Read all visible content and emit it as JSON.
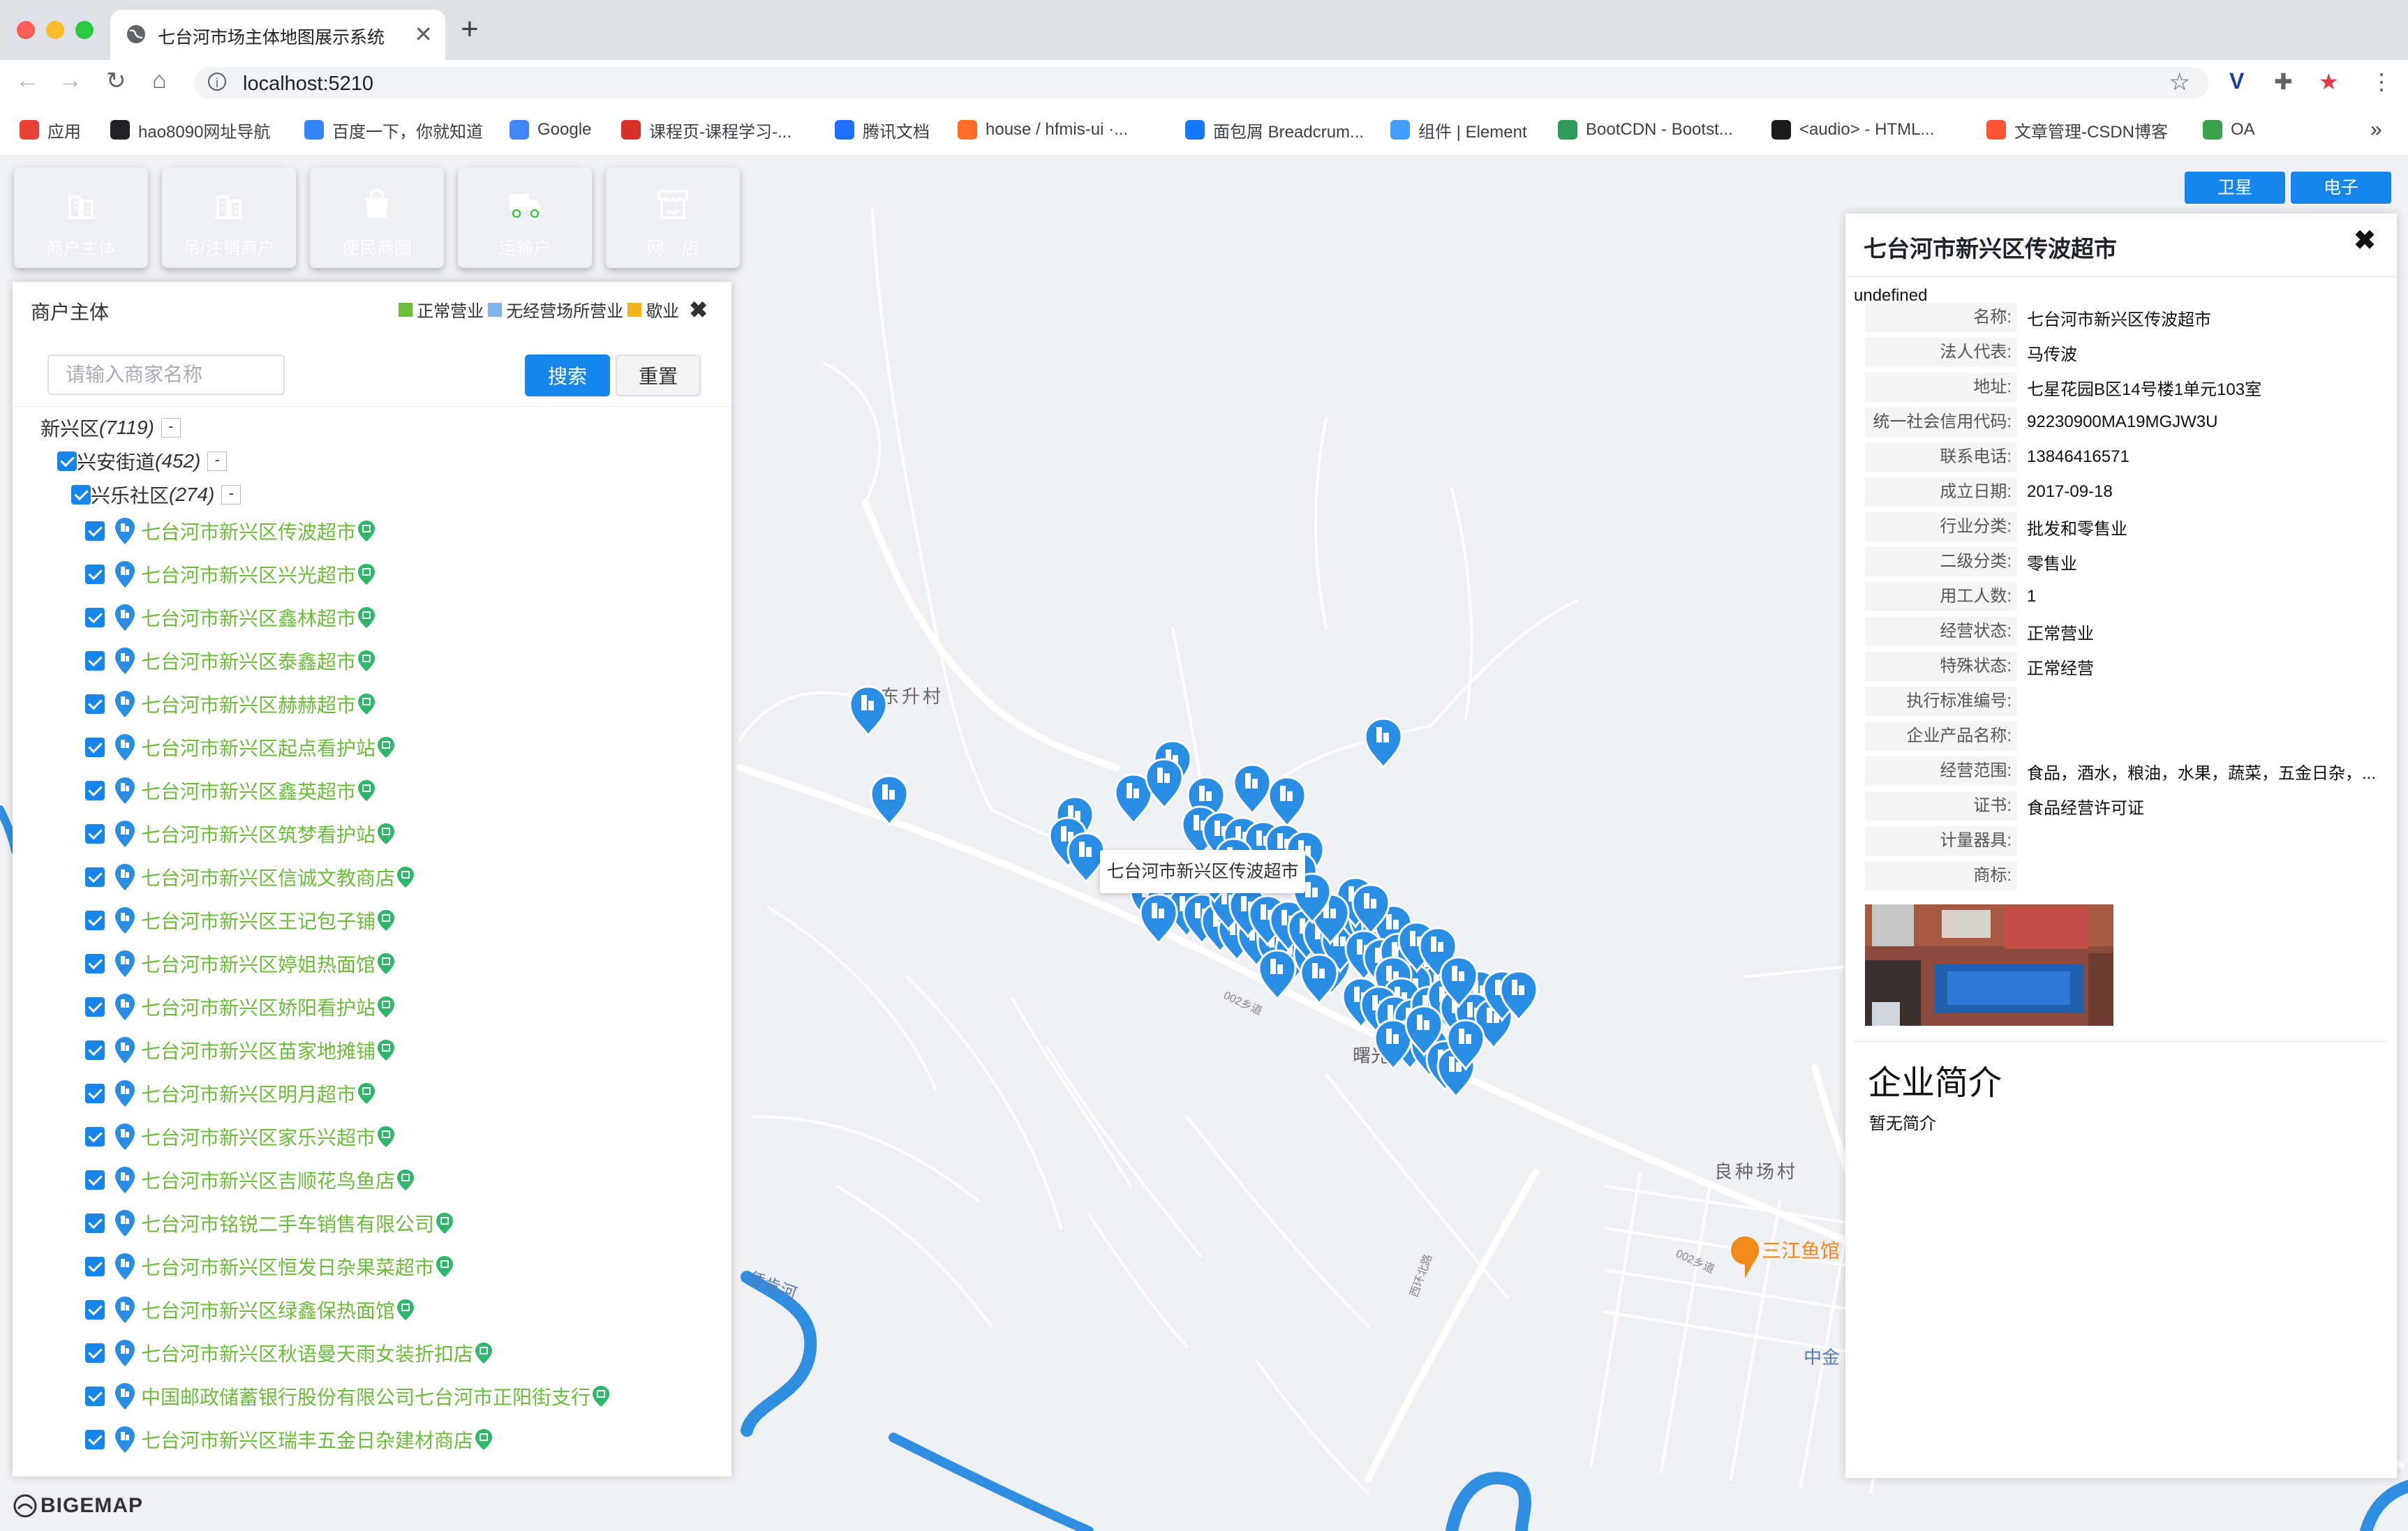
{
  "browser": {
    "tab_title": "七台河市场主体地图展示系统",
    "tab_close": "✕",
    "new_tab": "+",
    "url": "localhost:5210",
    "bookmarks": [
      {
        "label": "应用",
        "color": "#e94235"
      },
      {
        "label": "hao8090网址导航",
        "color": "#202124"
      },
      {
        "label": "百度一下，你就知道",
        "color": "#3385ff"
      },
      {
        "label": "Google",
        "color": "#4285f4"
      },
      {
        "label": "课程页-课程学习-...",
        "color": "#d93025"
      },
      {
        "label": "腾讯文档",
        "color": "#1e6fff"
      },
      {
        "label": "house / hfmis-ui ·...",
        "color": "#fc6d26"
      },
      {
        "label": "面包屑 Breadcrum...",
        "color": "#1677ff"
      },
      {
        "label": "组件 | Element",
        "color": "#409eff"
      },
      {
        "label": "BootCDN - Bootst...",
        "color": "#2d9c5a"
      },
      {
        "label": "<audio> - HTML...",
        "color": "#1b1b1b"
      },
      {
        "label": "文章管理-CSDN博客",
        "color": "#fc5531"
      },
      {
        "label": "OA",
        "color": "#3aa34a"
      }
    ],
    "more": "»"
  },
  "categories": [
    {
      "label": "商户主体",
      "color": "#3e8fe0"
    },
    {
      "label": "吊/注销商户",
      "color": "#f09e3c"
    },
    {
      "label": "便民商圈",
      "color": "#3f63e6"
    },
    {
      "label": "运输户",
      "color": "#1fc421"
    },
    {
      "label": "网　店",
      "color": "#f51414"
    }
  ],
  "left_panel": {
    "title": "商户主体",
    "legend": [
      {
        "label": "正常营业",
        "color": "#6bbd3a"
      },
      {
        "label": "无经营场所营业",
        "color": "#7fb3ec"
      },
      {
        "label": "歇业",
        "color": "#f3b51a"
      }
    ],
    "close": "✖",
    "search_placeholder": "请输入商家名称",
    "search_button": "搜索",
    "reset_button": "重置",
    "tree": {
      "district": {
        "name": "新兴区",
        "count": "(7119)",
        "toggle": "-"
      },
      "street": {
        "name": "兴安街道",
        "count": "(452)",
        "toggle": "-"
      },
      "community": {
        "name": "兴乐社区",
        "count": "(274)",
        "toggle": "-"
      },
      "items": [
        "七台河市新兴区传波超市",
        "七台河市新兴区兴光超市",
        "七台河市新兴区鑫林超市",
        "七台河市新兴区泰鑫超市",
        "七台河市新兴区赫赫超市",
        "七台河市新兴区起点看护站",
        "七台河市新兴区鑫英超市",
        "七台河市新兴区筑梦看护站",
        "七台河市新兴区信诚文教商店",
        "七台河市新兴区王记包子铺",
        "七台河市新兴区婷姐热面馆",
        "七台河市新兴区娇阳看护站",
        "七台河市新兴区苗家地摊铺",
        "七台河市新兴区明月超市",
        "七台河市新兴区家乐兴超市",
        "七台河市新兴区吉顺花鸟鱼店",
        "七台河市铭锐二手车销售有限公司",
        "七台河市新兴区恒发日杂果菜超市",
        "七台河市新兴区绿鑫保热面馆",
        "七台河市新兴区秋语曼天雨女装折扣店",
        "中国邮政储蓄银行股份有限公司七台河市正阳街支行",
        "七台河市新兴区瑞丰五金日杂建材商店"
      ]
    }
  },
  "map": {
    "labels": [
      "东升村",
      "良种场村",
      "三江鱼馆",
      "中金",
      "倭肯河",
      "002乡道",
      "西环北路",
      "曙光"
    ],
    "popup": "七台河市新兴区传波超市",
    "buttons": [
      "卫星",
      "电子"
    ],
    "logo": "BIGEMAP"
  },
  "detail": {
    "title": "七台河市新兴区传波超市",
    "close": "✖",
    "undefined_text": "undefined",
    "rows": [
      {
        "label": "名称:",
        "value": "七台河市新兴区传波超市"
      },
      {
        "label": "法人代表:",
        "value": "马传波"
      },
      {
        "label": "地址:",
        "value": "七星花园B区14号楼1单元103室"
      },
      {
        "label": "统一社会信用代码:",
        "value": "92230900MA19MGJW3U"
      },
      {
        "label": "联系电话:",
        "value": "13846416571"
      },
      {
        "label": "成立日期:",
        "value": "2017-09-18"
      },
      {
        "label": "行业分类:",
        "value": "批发和零售业"
      },
      {
        "label": "二级分类:",
        "value": "零售业"
      },
      {
        "label": "用工人数:",
        "value": "1"
      },
      {
        "label": "经营状态:",
        "value": "正常营业"
      },
      {
        "label": "特殊状态:",
        "value": "正常经营"
      },
      {
        "label": "执行标准编号:",
        "value": ""
      },
      {
        "label": "企业产品名称:",
        "value": ""
      },
      {
        "label": "经营范围:",
        "value": "食品，酒水，粮油，水果，蔬菜，五金日杂，..."
      },
      {
        "label": "证书:",
        "value": "食品经营许可证"
      },
      {
        "label": "计量器具:",
        "value": ""
      },
      {
        "label": "商标:",
        "value": ""
      }
    ],
    "intro_title": "企业简介",
    "intro_body": "暂无简介"
  }
}
